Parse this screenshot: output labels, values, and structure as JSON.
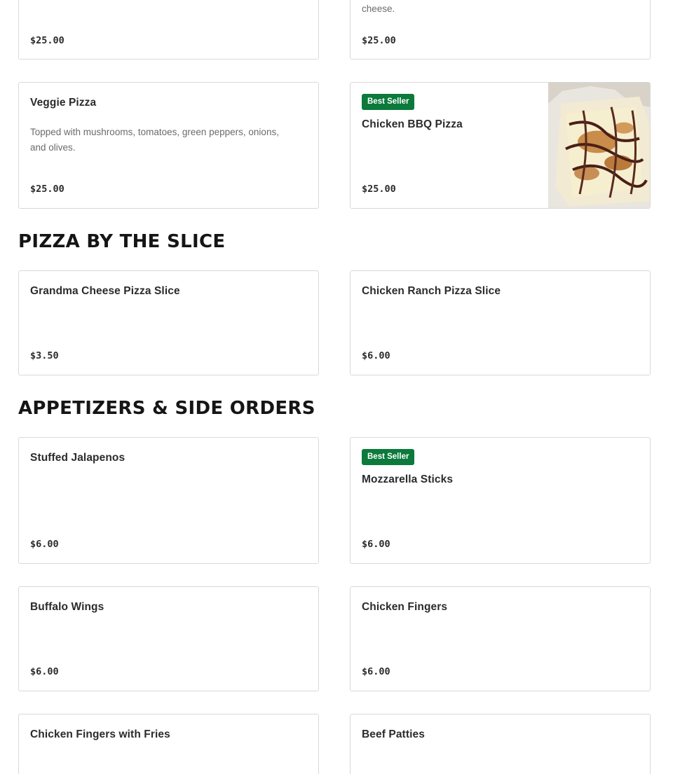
{
  "menu": {
    "partial_top": {
      "left_price": "$25.00",
      "right_desc": "cheese.",
      "right_price": "$25.00"
    },
    "veggie_pizza": {
      "name": "Veggie Pizza",
      "description": "Topped with mushrooms, tomatoes, green peppers, onions, and olives.",
      "price": "$25.00"
    },
    "chicken_bbq_pizza": {
      "badge": "Best Seller",
      "name": "Chicken BBQ Pizza",
      "price": "$25.00",
      "image_icon": "pizza-photo"
    },
    "section_slice": {
      "heading": "PIZZA BY THE SLICE",
      "items": [
        {
          "name": "Grandma Cheese Pizza Slice",
          "price": "$3.50"
        },
        {
          "name": "Chicken Ranch Pizza Slice",
          "price": "$6.00"
        }
      ]
    },
    "section_appetizers": {
      "heading": "APPETIZERS & SIDE ORDERS",
      "items": [
        {
          "name": "Stuffed Jalapenos",
          "price": "$6.00"
        },
        {
          "badge": "Best Seller",
          "name": "Mozzarella Sticks",
          "price": "$6.00"
        },
        {
          "name": "Buffalo Wings",
          "price": "$6.00"
        },
        {
          "name": "Chicken Fingers",
          "price": "$6.00"
        },
        {
          "name": "Chicken Fingers with Fries"
        },
        {
          "name": "Beef Patties"
        }
      ]
    }
  },
  "colors": {
    "badge_bg": "#0b7a3b",
    "card_border": "#d9d9d9"
  }
}
